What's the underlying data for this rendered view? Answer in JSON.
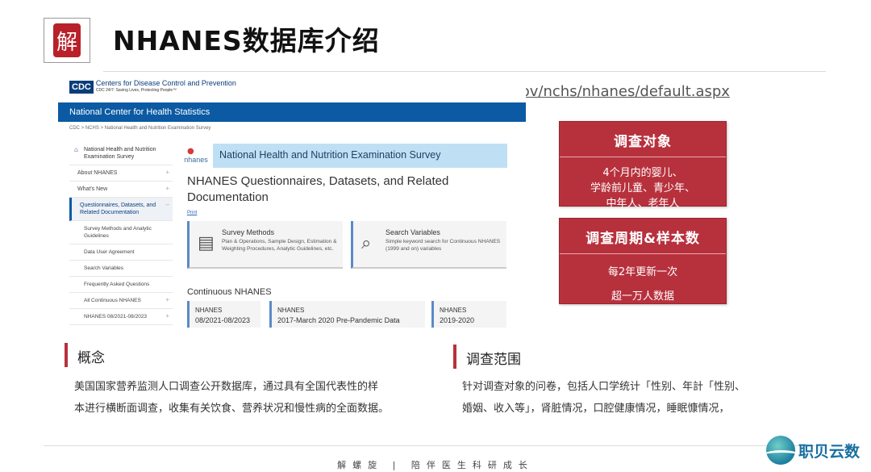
{
  "header": {
    "seal_char": "解",
    "title": "NHANES数据库介绍"
  },
  "url_line": "NHANES数据库网址：https://wwwn.cdc.gov/nchs/nhanes/default.aspx",
  "screenshot": {
    "cdc_mark": "CDC",
    "cdc_name": "Centers for Disease Control and Prevention",
    "cdc_tagline": "CDC 24/7: Saving Lives, Protecting People™",
    "nchs_bar": "National Center for Health Statistics",
    "breadcrumb": "CDC  >  NCHS  >  National Health and Nutrition Examination Survey",
    "nav": {
      "home": "National Health and Nutrition Examination Survey",
      "items": [
        {
          "label": "About NHANES",
          "plus": "+"
        },
        {
          "label": "What's New",
          "plus": "+"
        },
        {
          "label": "Questionnaires, Datasets, and Related Documentation",
          "plus": "–"
        },
        {
          "label": "Survey Methods and Analytic Guidelines"
        },
        {
          "label": "Data User Agreement"
        },
        {
          "label": "Search Variables"
        },
        {
          "label": "Frequently Asked Questions"
        },
        {
          "label": "All Continuous NHANES",
          "plus": "+"
        },
        {
          "label": "NHANES 08/2021-08/2023",
          "plus": "+"
        }
      ]
    },
    "nhanes_logo": "nhanes",
    "banner_title": "National Health and Nutrition Examination Survey",
    "page_heading": "NHANES Questionnaires, Datasets, and Related Documentation",
    "print": "Print",
    "cards": [
      {
        "title": "Survey Methods",
        "desc": "Plan & Operations, Sample Design, Estimation & Weighting Procedures, Analytic Guidelines, etc."
      },
      {
        "title": "Search Variables",
        "desc": "Simple keyword search for Continuous NHANES (1999 and on) variables"
      }
    ],
    "continuous_heading": "Continuous NHANES",
    "cycles": [
      {
        "a": "NHANES",
        "b": "08/2021-08/2023"
      },
      {
        "a": "NHANES",
        "b": "2017-March 2020 Pre-Pandemic Data"
      },
      {
        "a": "NHANES",
        "b": "2019-2020"
      }
    ]
  },
  "box1": {
    "title": "调查对象",
    "lines": [
      "4个月内的婴儿、",
      "学龄前儿童、青少年、",
      "中年人、老年人"
    ]
  },
  "box2": {
    "title": "调查周期&样本数",
    "lines": [
      "每2年更新一次",
      "超一万人数据"
    ]
  },
  "concept": {
    "title": "概念",
    "lines": [
      "美国国家营养监测人口调查公开数据库，通过具有全国代表性的样",
      "本进行横断面调查，收集有关饮食、营养状况和慢性病的全面数据。"
    ]
  },
  "scope": {
    "title": "调查范围",
    "lines": [
      "针对调查对象的问卷，包括人口学统计「性别、年計「性别、",
      "婚姻、收入等」，肾脏情况，口腔健康情况，睡眠慷情况，"
    ]
  },
  "footer": "解螺旋  |  陪伴医生科研成长",
  "brand": "职贝云数",
  "colors": {
    "accent_red": "#b7313d",
    "cdc_blue": "#0b5aa3"
  }
}
